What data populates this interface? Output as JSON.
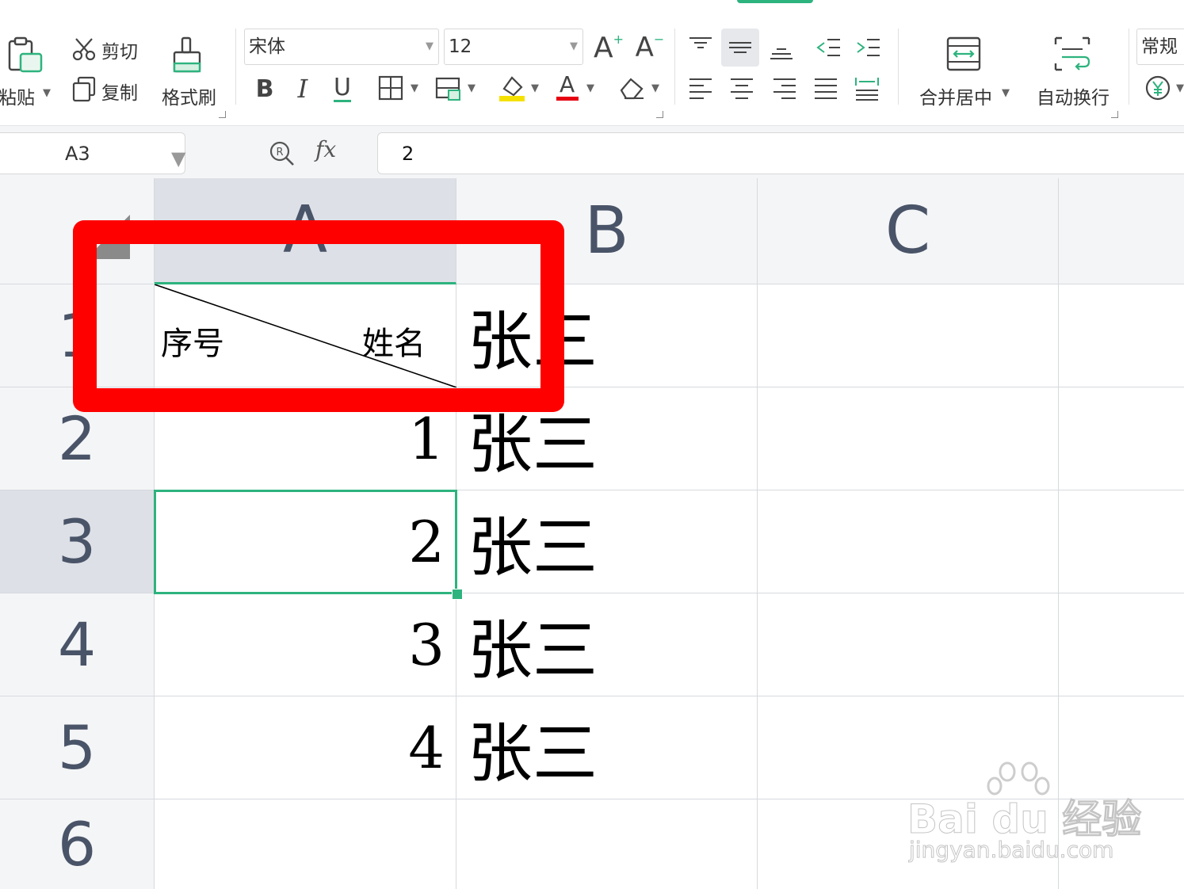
{
  "ribbon": {
    "paste_label": "粘贴",
    "cut_label": "剪切",
    "copy_label": "复制",
    "format_painter_label": "格式刷",
    "font_name": "宋体",
    "font_size": "12",
    "increase_font": "A",
    "decrease_font": "A",
    "bold": "B",
    "italic": "I",
    "underline": "U",
    "font_color_glyph": "A",
    "merge_center_label": "合并居中",
    "wrap_text_label": "自动换行",
    "number_format": "常规",
    "colors": {
      "accent": "#2db37e",
      "highlight": "#f5e100",
      "font_red": "#e60012"
    }
  },
  "formula_bar": {
    "cell_ref": "A3",
    "fx_symbol": "fx",
    "value": "2"
  },
  "columns": [
    "A",
    "B",
    "C"
  ],
  "rows": [
    "1",
    "2",
    "3",
    "4",
    "5",
    "6"
  ],
  "cells": {
    "header_left": "序号",
    "header_right": "姓名",
    "b1": "张三",
    "a2": "1",
    "b2": "张三",
    "a3": "2",
    "b3": "张三",
    "a4": "3",
    "b4": "张三",
    "a5": "4",
    "b5": "张三"
  },
  "selection": {
    "cell": "A3",
    "color": "#2db37e"
  },
  "annotation": {
    "color": "#ff0000"
  },
  "watermark": {
    "brand": "Bai du 经验",
    "url": "jingyan.baidu.com"
  }
}
